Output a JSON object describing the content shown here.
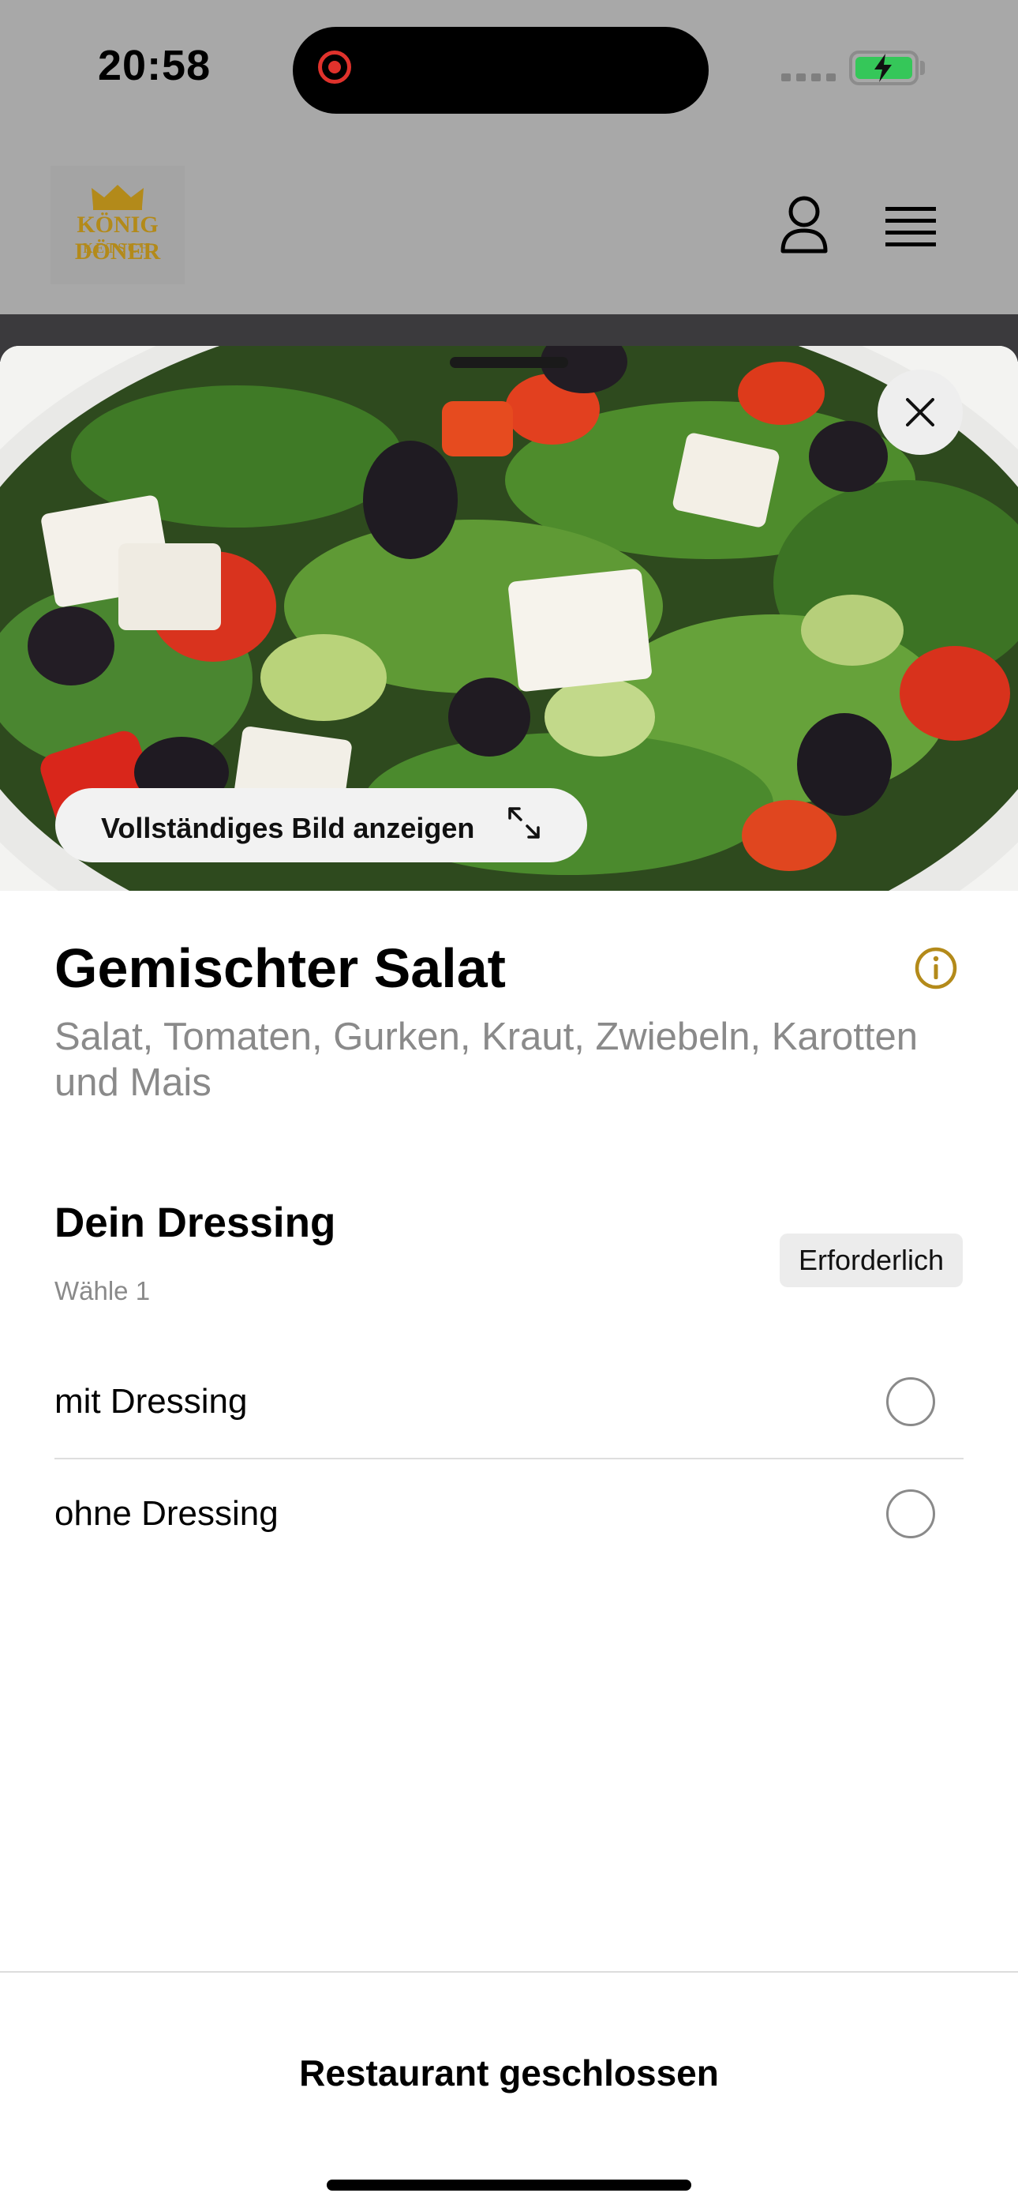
{
  "status_bar": {
    "time": "20:58"
  },
  "header": {
    "logo_title": "KÖNIG DÖNER",
    "logo_subtitle": "KETSCH",
    "account_icon": "person-icon",
    "menu_icon": "hamburger-menu-icon"
  },
  "sheet": {
    "image_button_label": "Vollständiges Bild anzeigen",
    "product": {
      "title": "Gemischter Salat",
      "description": "Salat, Tomaten, Gurken, Kraut, Zwiebeln, Karotten und Mais"
    },
    "option_group": {
      "title": "Dein Dressing",
      "subtitle": "Wähle 1",
      "badge": "Erforderlich",
      "options": [
        {
          "label": "mit Dressing",
          "selected": false
        },
        {
          "label": "ohne Dressing",
          "selected": false
        }
      ]
    },
    "footer_label": "Restaurant geschlossen"
  },
  "colors": {
    "accent_gold": "#b38a1a",
    "battery_green": "#35c759",
    "record_red": "#e0322c"
  }
}
